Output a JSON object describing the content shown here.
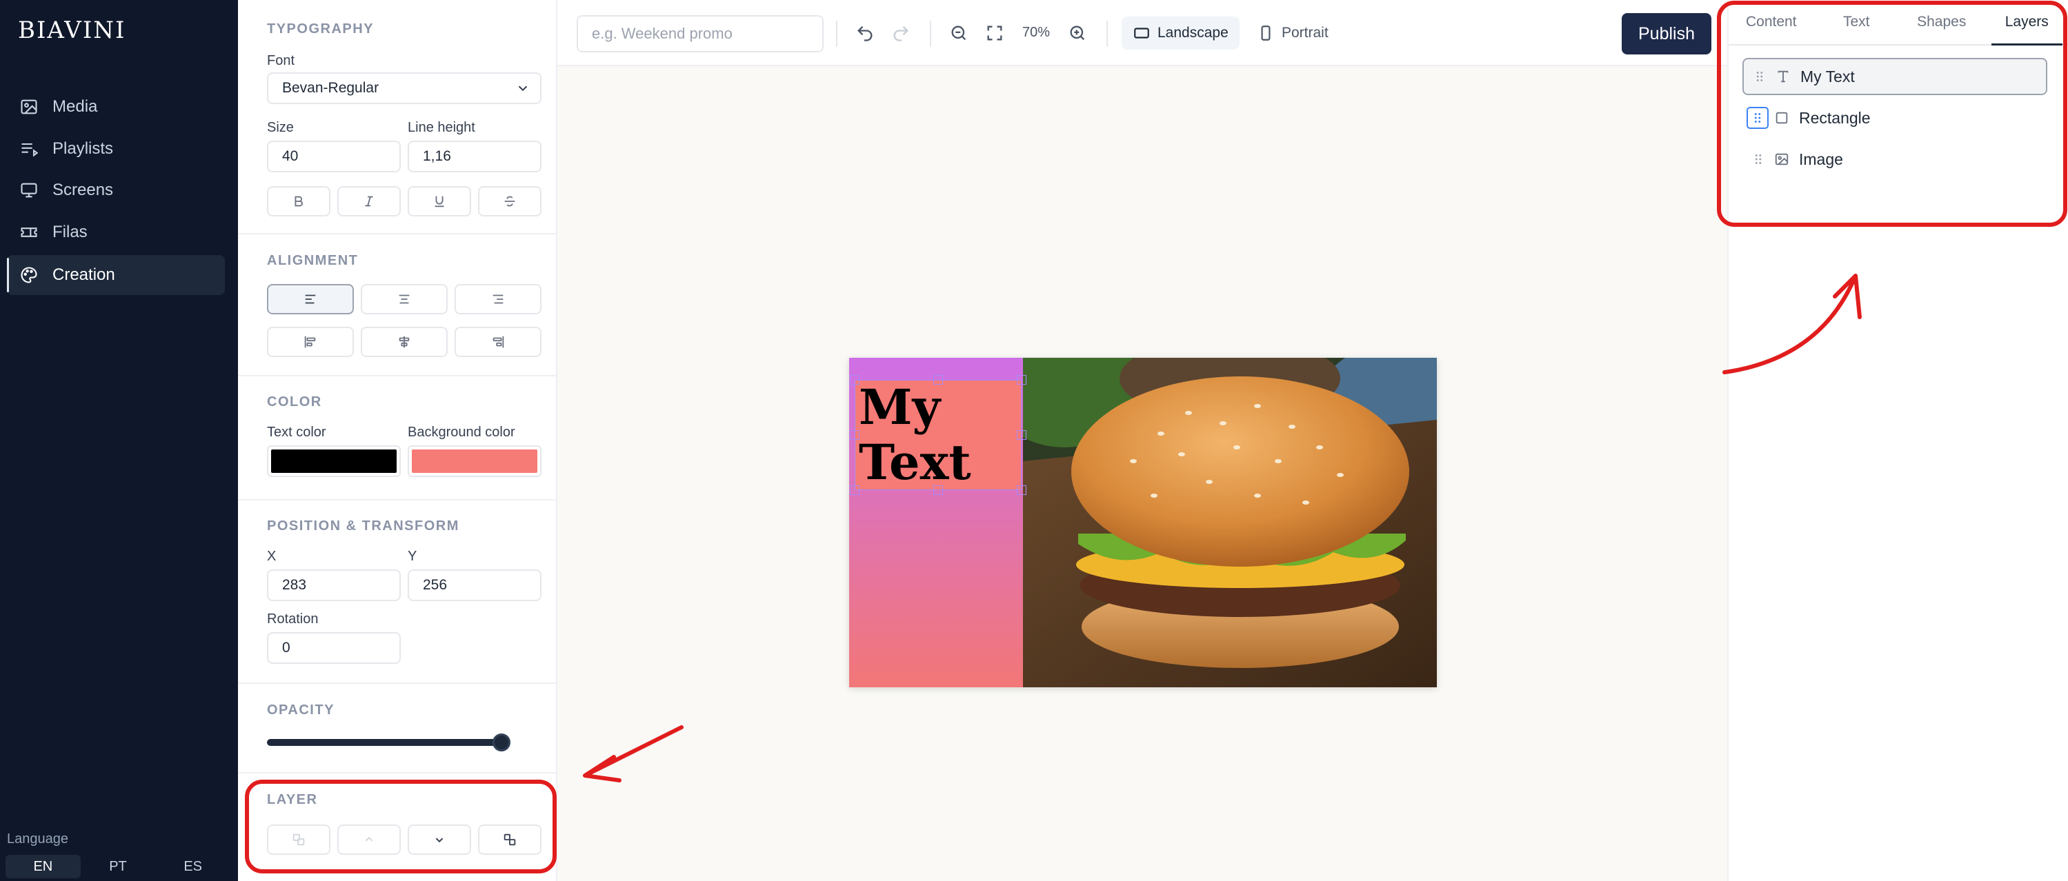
{
  "app": {
    "logo": "BIAVINI"
  },
  "nav": {
    "items": [
      {
        "label": "Media",
        "icon": "image-icon"
      },
      {
        "label": "Playlists",
        "icon": "playlist-icon"
      },
      {
        "label": "Screens",
        "icon": "monitor-icon"
      },
      {
        "label": "Filas",
        "icon": "ticket-icon"
      },
      {
        "label": "Creation",
        "icon": "palette-icon",
        "active": true
      }
    ],
    "language_label": "Language",
    "languages": [
      "EN",
      "PT",
      "ES"
    ],
    "active_language": "EN"
  },
  "typography": {
    "title": "TYPOGRAPHY",
    "font_label": "Font",
    "font_value": "Bevan-Regular",
    "size_label": "Size",
    "size_value": "40",
    "line_height_label": "Line height",
    "line_height_value": "1,16"
  },
  "alignment": {
    "title": "ALIGNMENT"
  },
  "color": {
    "title": "COLOR",
    "text_color_label": "Text color",
    "text_color": "#000000",
    "background_color_label": "Background color",
    "background_color": "#f67a76"
  },
  "position": {
    "title": "POSITION & TRANSFORM",
    "x_label": "X",
    "x_value": "283",
    "y_label": "Y",
    "y_value": "256",
    "rotation_label": "Rotation",
    "rotation_value": "0"
  },
  "opacity": {
    "title": "OPACITY",
    "value_percent": 100
  },
  "layer": {
    "title": "LAYER"
  },
  "toolbar": {
    "name_placeholder": "e.g. Weekend promo",
    "zoom": "70%",
    "landscape_label": "Landscape",
    "portrait_label": "Portrait",
    "active_orientation": "Landscape",
    "publish_label": "Publish"
  },
  "canvas": {
    "text_content_line1": "My",
    "text_content_line2": "Text",
    "rect_gradient": [
      "#cf6fe6",
      "#f27777"
    ]
  },
  "right_panel": {
    "tabs": [
      "Content",
      "Text",
      "Shapes",
      "Layers"
    ],
    "active_tab": "Layers",
    "layers": [
      {
        "name": "My Text",
        "icon": "text-icon",
        "selected": true
      },
      {
        "name": "Rectangle",
        "icon": "square-icon"
      },
      {
        "name": "Image",
        "icon": "image-icon"
      }
    ]
  },
  "colors": {
    "nav_bg": "#0f172a",
    "accent": "#1e2a4a",
    "annotation": "#e11d1d"
  }
}
